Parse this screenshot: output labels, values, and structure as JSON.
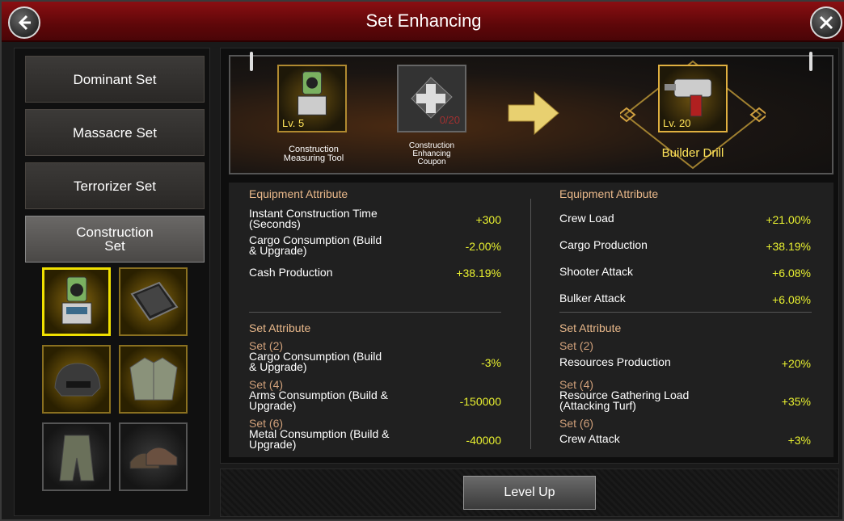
{
  "window": {
    "title": "Set Enhancing",
    "back_icon": "back-arrow-icon",
    "close_icon": "close-icon"
  },
  "sets": [
    {
      "label": "Dominant Set",
      "active": false
    },
    {
      "label": "Massacre Set",
      "active": false
    },
    {
      "label": "Terrorizer Set",
      "active": false
    },
    {
      "label": "Construction\nSet",
      "active": true
    }
  ],
  "equipment_slots": [
    {
      "icon": "measuring-tool-icon",
      "selected": true
    },
    {
      "icon": "tablet-icon",
      "selected": false
    },
    {
      "icon": "helmet-icon",
      "selected": false
    },
    {
      "icon": "jacket-icon",
      "selected": false
    },
    {
      "icon": "overalls-icon",
      "selected": false
    },
    {
      "icon": "shoes-icon",
      "selected": false
    }
  ],
  "enhance": {
    "source_item": {
      "level": "Lv. 5",
      "name": "Construction\nMeasuring Tool"
    },
    "material": {
      "count": "0/20",
      "name": "Construction\nEnhancing\nCoupon"
    },
    "result_item": {
      "level": "Lv. 20",
      "name": "Builder Drill"
    }
  },
  "left_attributes": {
    "equipment_header": "Equipment Attribute",
    "equipment": [
      {
        "label": "Instant Construction Time\n(Seconds)",
        "value": "+300"
      },
      {
        "label": "Cargo Consumption (Build\n& Upgrade)",
        "value": "-2.00%"
      },
      {
        "label": "Cash Production",
        "value": "+38.19%"
      }
    ],
    "set_header": "Set Attribute",
    "set": [
      {
        "tier": "Set (2)",
        "label": "Cargo Consumption (Build\n& Upgrade)",
        "value": "-3%"
      },
      {
        "tier": "Set (4)",
        "label": "Arms Consumption (Build &\nUpgrade)",
        "value": "-150000"
      },
      {
        "tier": "Set (6)",
        "label": "Metal Consumption (Build &\nUpgrade)",
        "value": "-40000"
      }
    ]
  },
  "right_attributes": {
    "equipment_header": "Equipment Attribute",
    "equipment": [
      {
        "label": "Crew Load",
        "value": "+21.00%"
      },
      {
        "label": "Cargo Production",
        "value": "+38.19%"
      },
      {
        "label": "Shooter Attack",
        "value": "+6.08%"
      },
      {
        "label": "Bulker Attack",
        "value": "+6.08%"
      }
    ],
    "set_header": "Set Attribute",
    "set": [
      {
        "tier": "Set (2)",
        "label": "Resources Production",
        "value": "+20%"
      },
      {
        "tier": "Set (4)",
        "label": "Resource Gathering Load\n(Attacking Turf)",
        "value": "+35%"
      },
      {
        "tier": "Set (6)",
        "label": "Crew Attack",
        "value": "+3%"
      }
    ]
  },
  "actions": {
    "level_up": "Level Up"
  },
  "colors": {
    "title_bar": "#6a090c",
    "value_text": "#e8f030",
    "header_text": "#e9b88a",
    "selection": "#f0e000"
  }
}
